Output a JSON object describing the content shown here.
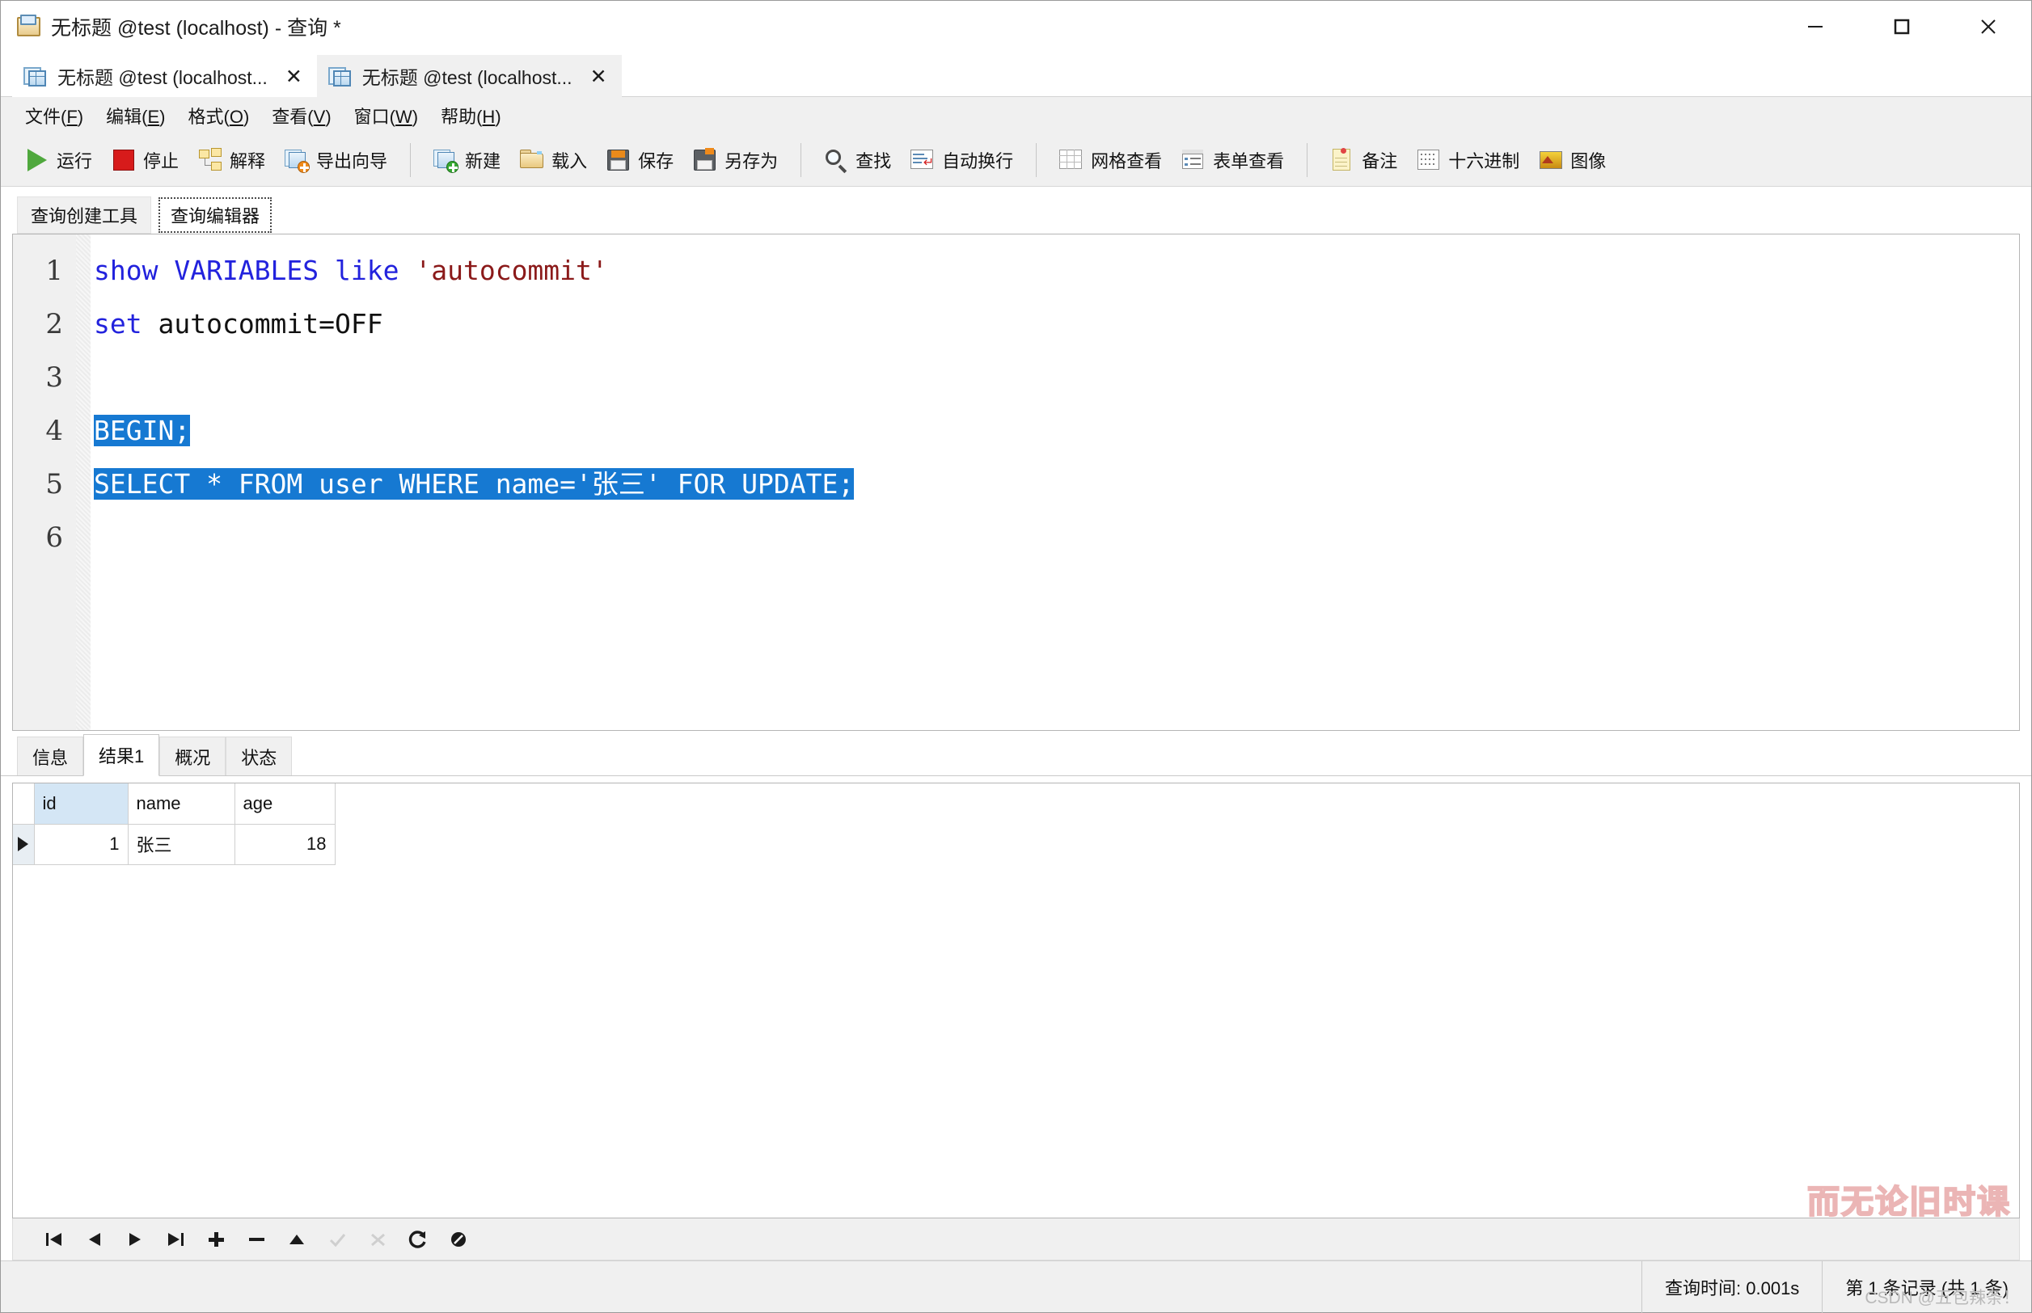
{
  "window": {
    "title": "无标题 @test (localhost) - 查询 *",
    "icon": "query-window-icon",
    "controls": {
      "minimize": "minimize-icon",
      "maximize": "maximize-icon",
      "close": "close-icon"
    }
  },
  "doc_tabs": [
    {
      "label": "无标题 @test (localhost...",
      "active": true,
      "close": "✕",
      "icon": "query-tab-icon"
    },
    {
      "label": "无标题 @test (localhost...",
      "active": false,
      "close": "✕",
      "icon": "query-tab-icon"
    }
  ],
  "menubar": [
    {
      "name": "文件",
      "key": "F"
    },
    {
      "name": "编辑",
      "key": "E"
    },
    {
      "name": "格式",
      "key": "O"
    },
    {
      "name": "查看",
      "key": "V"
    },
    {
      "name": "窗口",
      "key": "W"
    },
    {
      "name": "帮助",
      "key": "H"
    }
  ],
  "toolbar": [
    {
      "label": "运行",
      "icon": "run-icon"
    },
    {
      "label": "停止",
      "icon": "stop-icon"
    },
    {
      "label": "解释",
      "icon": "explain-icon"
    },
    {
      "label": "导出向导",
      "icon": "export-wizard-icon"
    },
    {
      "label": "新建",
      "icon": "new-query-icon"
    },
    {
      "label": "载入",
      "icon": "open-folder-icon"
    },
    {
      "label": "保存",
      "icon": "save-icon"
    },
    {
      "label": "另存为",
      "icon": "save-as-icon"
    },
    {
      "label": "查找",
      "icon": "search-icon"
    },
    {
      "label": "自动换行",
      "icon": "word-wrap-icon"
    },
    {
      "label": "网格查看",
      "icon": "grid-view-icon"
    },
    {
      "label": "表单查看",
      "icon": "form-view-icon"
    },
    {
      "label": "备注",
      "icon": "note-icon"
    },
    {
      "label": "十六进制",
      "icon": "hex-icon"
    },
    {
      "label": "图像",
      "icon": "image-icon"
    }
  ],
  "inner_tabs": [
    {
      "label": "查询创建工具",
      "active": false
    },
    {
      "label": "查询编辑器",
      "active": true
    }
  ],
  "editor": {
    "line_numbers": [
      "1",
      "2",
      "3",
      "4",
      "5",
      "6"
    ],
    "lines": [
      {
        "n": "1",
        "selected": false,
        "tokens": [
          {
            "t": "show VARIABLES like ",
            "c": "kw"
          },
          {
            "t": "'autocommit'",
            "c": "str"
          }
        ]
      },
      {
        "n": "2",
        "selected": false,
        "tokens": [
          {
            "t": "set ",
            "c": "kw"
          },
          {
            "t": "autocommit=OFF",
            "c": "plain"
          }
        ]
      },
      {
        "n": "3",
        "selected": false,
        "tokens": []
      },
      {
        "n": "4",
        "selected": true,
        "tokens": [
          {
            "t": "BEGIN;",
            "c": "plain"
          }
        ]
      },
      {
        "n": "5",
        "selected": true,
        "tokens": [
          {
            "t": "SELECT * FROM user WHERE name='张三' FOR UPDATE;",
            "c": "plain"
          }
        ]
      },
      {
        "n": "6",
        "selected": false,
        "tokens": []
      }
    ]
  },
  "result_tabs": [
    {
      "label": "信息",
      "active": false
    },
    {
      "label": "结果1",
      "active": true
    },
    {
      "label": "概况",
      "active": false
    },
    {
      "label": "状态",
      "active": false
    }
  ],
  "grid": {
    "columns": [
      "id",
      "name",
      "age"
    ],
    "selected_column": "id",
    "rows": [
      {
        "marker": "▶",
        "id": "1",
        "name": "张三",
        "age": "18"
      }
    ]
  },
  "nav_buttons": [
    {
      "name": "first-record-button",
      "icon": "first-icon",
      "disabled": false
    },
    {
      "name": "prev-record-button",
      "icon": "prev-icon",
      "disabled": false
    },
    {
      "name": "next-record-button",
      "icon": "next-icon",
      "disabled": false
    },
    {
      "name": "last-record-button",
      "icon": "last-icon",
      "disabled": false
    },
    {
      "name": "add-record-button",
      "icon": "plus-icon",
      "disabled": false
    },
    {
      "name": "delete-record-button",
      "icon": "minus-icon",
      "disabled": false
    },
    {
      "name": "apply-up-button",
      "icon": "up-arrow-icon",
      "disabled": false
    },
    {
      "name": "confirm-button",
      "icon": "check-icon",
      "disabled": true
    },
    {
      "name": "cancel-button",
      "icon": "x-icon",
      "disabled": true
    },
    {
      "name": "refresh-button",
      "icon": "refresh-icon",
      "disabled": false
    },
    {
      "name": "stop-button",
      "icon": "stop-circle-icon",
      "disabled": false
    }
  ],
  "statusbar": {
    "query_time": "查询时间: 0.001s",
    "record_info": "第 1 条记录 (共 1 条)"
  },
  "watermarks": {
    "grid_overlay": "而无论旧时课",
    "csdn": "CSDN @五包辣条！"
  },
  "colors": {
    "selection_blue": "#1679d2",
    "keyword_blue": "#2222dd",
    "string_red": "#8b1a1a",
    "chrome_gray": "#f0f0f0",
    "header_select": "#d4e6f5"
  }
}
